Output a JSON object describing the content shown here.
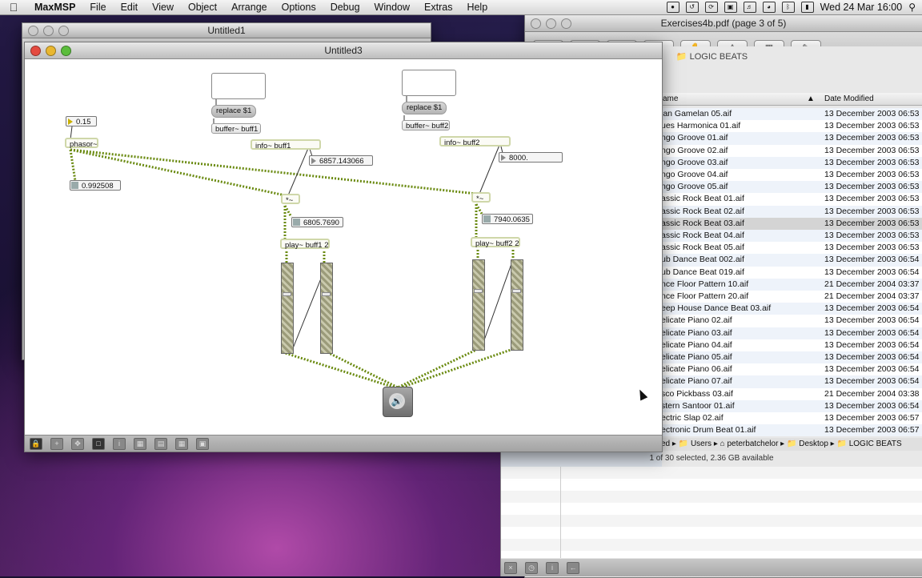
{
  "menubar": {
    "app_name": "MaxMSP",
    "items": [
      "File",
      "Edit",
      "View",
      "Object",
      "Arrange",
      "Options",
      "Debug",
      "Window",
      "Extras",
      "Help"
    ],
    "clock": "Wed 24 Mar  16:00"
  },
  "windows": {
    "untitled1_title": "Untitled1",
    "patcher_title": "Untitled3",
    "pdf_title": "Exercises4b.pdf (page 3 of 5)",
    "finder_title": "LOGIC BEATS"
  },
  "patch": {
    "left_chain": {
      "float_value": "0.15",
      "phasor": "phasor~",
      "phasor_out": "0.992508"
    },
    "buff1": {
      "replace_msg": "replace $1",
      "buffer": "buffer~ buff1",
      "info": "info~ buff1",
      "info_value": "6857.143066",
      "mult": "*~",
      "mult_value": "6805.7690",
      "play": "play~ buff1 2"
    },
    "buff2": {
      "replace_msg": "replace $1",
      "buffer": "buffer~ buff2",
      "info": "info~ buff2",
      "info_value": "8000.",
      "mult": "*~",
      "mult_value": "7940.0635",
      "play": "play~ buff2 2"
    }
  },
  "finder": {
    "columns": {
      "name": "ame",
      "date": "Date Modified"
    },
    "files": [
      {
        "name": "ian Gamelan 05.aif",
        "date": "13 December 2003 06:53"
      },
      {
        "name": "ues Harmonica 01.aif",
        "date": "13 December 2003 06:53"
      },
      {
        "name": "ngo Groove 01.aif",
        "date": "13 December 2003 06:53"
      },
      {
        "name": "ngo Groove 02.aif",
        "date": "13 December 2003 06:53"
      },
      {
        "name": "ngo Groove 03.aif",
        "date": "13 December 2003 06:53"
      },
      {
        "name": "ngo Groove 04.aif",
        "date": "13 December 2003 06:53"
      },
      {
        "name": "ngo Groove 05.aif",
        "date": "13 December 2003 06:53"
      },
      {
        "name": "assic Rock Beat 01.aif",
        "date": "13 December 2003 06:53"
      },
      {
        "name": "assic Rock Beat 02.aif",
        "date": "13 December 2003 06:53"
      },
      {
        "name": "assic Rock Beat 03.aif",
        "date": "13 December 2003 06:53"
      },
      {
        "name": "assic Rock Beat 04.aif",
        "date": "13 December 2003 06:53"
      },
      {
        "name": "assic Rock Beat 05.aif",
        "date": "13 December 2003 06:53"
      },
      {
        "name": "ub Dance Beat 002.aif",
        "date": "13 December 2003 06:54"
      },
      {
        "name": "ub Dance Beat 019.aif",
        "date": "13 December 2003 06:54"
      },
      {
        "name": "nce Floor Pattern 10.aif",
        "date": "21 December 2004 03:37"
      },
      {
        "name": "nce Floor Pattern 20.aif",
        "date": "21 December 2004 03:37"
      },
      {
        "name": "eep House Dance Beat 03.aif",
        "date": "13 December 2003 06:54"
      },
      {
        "name": "elicate Piano 02.aif",
        "date": "13 December 2003 06:54"
      },
      {
        "name": "elicate Piano 03.aif",
        "date": "13 December 2003 06:54"
      },
      {
        "name": "elicate Piano 04.aif",
        "date": "13 December 2003 06:54"
      },
      {
        "name": "elicate Piano 05.aif",
        "date": "13 December 2003 06:54"
      },
      {
        "name": "elicate Piano 06.aif",
        "date": "13 December 2003 06:54"
      },
      {
        "name": "elicate Piano 07.aif",
        "date": "13 December 2003 06:54"
      },
      {
        "name": "sco Pickbass 03.aif",
        "date": "21 December 2004 03:38"
      },
      {
        "name": "stern Santoor 01.aif",
        "date": "13 December 2003 06:54"
      },
      {
        "name": "ectric Slap 02.aif",
        "date": "13 December 2003 06:57"
      },
      {
        "name": "ectronic Drum Beat 01.aif",
        "date": "13 December 2003 06:57"
      }
    ],
    "path": [
      "ed",
      "Users",
      "peterbatchelor",
      "Desktop",
      "LOGIC BEATS"
    ],
    "status": "1 of 30 selected, 2.36 GB available"
  }
}
